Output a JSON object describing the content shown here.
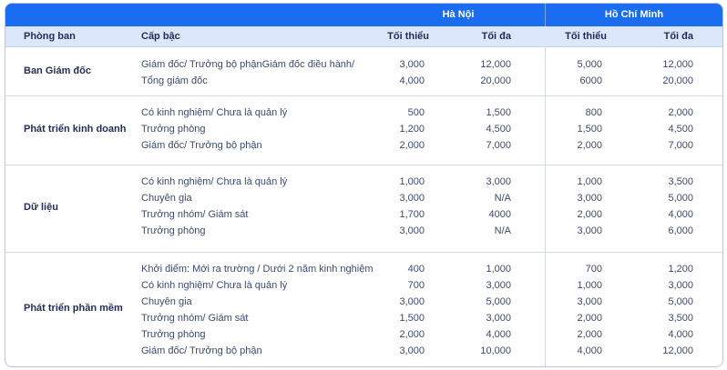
{
  "header": {
    "city_hn": "Hà Nội",
    "city_hcm": "Hồ Chí Minh",
    "col_department": "Phòng ban",
    "col_level": "Cấp bậc",
    "col_hn_min": "Tối thiểu",
    "col_hn_max": "Tối đa",
    "col_hcm_min": "Tối thiểu",
    "col_hcm_max": "Tối đa"
  },
  "groups": [
    {
      "department": "Ban Giám đốc",
      "rows": [
        {
          "level": "Giám đốc/ Trưởng bộ phậnGiám đốc điều hành/",
          "hn_min": "3,000",
          "hn_max": "12,000",
          "hcm_min": "5,000",
          "hcm_max": "12,000"
        },
        {
          "level": "Tổng giám đốc",
          "hn_min": "4,000",
          "hn_max": "20,000",
          "hcm_min": "6000",
          "hcm_max": "20,000"
        }
      ]
    },
    {
      "department": "Phát triển kinh doanh",
      "rows": [
        {
          "level": "Có kinh nghiệm/ Chưa là quản lý",
          "hn_min": "500",
          "hn_max": "1,500",
          "hcm_min": "800",
          "hcm_max": "2,000"
        },
        {
          "level": "Trưởng phòng",
          "hn_min": "1,200",
          "hn_max": "4,500",
          "hcm_min": "1,500",
          "hcm_max": "4,500"
        },
        {
          "level": "Giám đốc/ Trưởng bộ phận",
          "hn_min": "2,000",
          "hn_max": "7,000",
          "hcm_min": "2,000",
          "hcm_max": "7,000"
        }
      ]
    },
    {
      "department": "Dữ liệu",
      "rows": [
        {
          "level": "Có kinh nghiệm/ Chưa là quản lý",
          "hn_min": "1,000",
          "hn_max": "3,000",
          "hcm_min": "1,000",
          "hcm_max": "3,500"
        },
        {
          "level": "Chuyên gia",
          "hn_min": "3,000",
          "hn_max": "N/A",
          "hcm_min": "3,000",
          "hcm_max": "5,000"
        },
        {
          "level": "Trưởng nhóm/ Giám sát",
          "hn_min": "1,700",
          "hn_max": "4000",
          "hcm_min": "2,000",
          "hcm_max": "4,000"
        },
        {
          "level": "Trưởng phòng",
          "hn_min": "3,000",
          "hn_max": "N/A",
          "hcm_min": "3,000",
          "hcm_max": "6,000"
        }
      ]
    },
    {
      "department": "Phát triển phần mềm",
      "rows": [
        {
          "level": "Khởi điểm: Mới ra trường / Dưới 2 năm kinh nghiệm",
          "hn_min": "400",
          "hn_max": "1,000",
          "hcm_min": "700",
          "hcm_max": "1,200"
        },
        {
          "level": "Có kinh nghiệm/ Chưa là quản lý",
          "hn_min": "700",
          "hn_max": "3,000",
          "hcm_min": "1,000",
          "hcm_max": "3,000"
        },
        {
          "level": "Chuyên gia",
          "hn_min": "3,000",
          "hn_max": "5,000",
          "hcm_min": "3,000",
          "hcm_max": "5,000"
        },
        {
          "level": "Trưởng nhóm/ Giám sát",
          "hn_min": "1,500",
          "hn_max": "3,000",
          "hcm_min": "2,000",
          "hcm_max": "3,500"
        },
        {
          "level": "Trưởng phòng",
          "hn_min": "2,000",
          "hn_max": "4,000",
          "hcm_min": "2,000",
          "hcm_max": "4,000"
        },
        {
          "level": "Giám đốc/ Trưởng bộ phận",
          "hn_min": "3,000",
          "hn_max": "10,000",
          "hcm_min": "4,000",
          "hcm_max": "12,000"
        }
      ]
    }
  ]
}
